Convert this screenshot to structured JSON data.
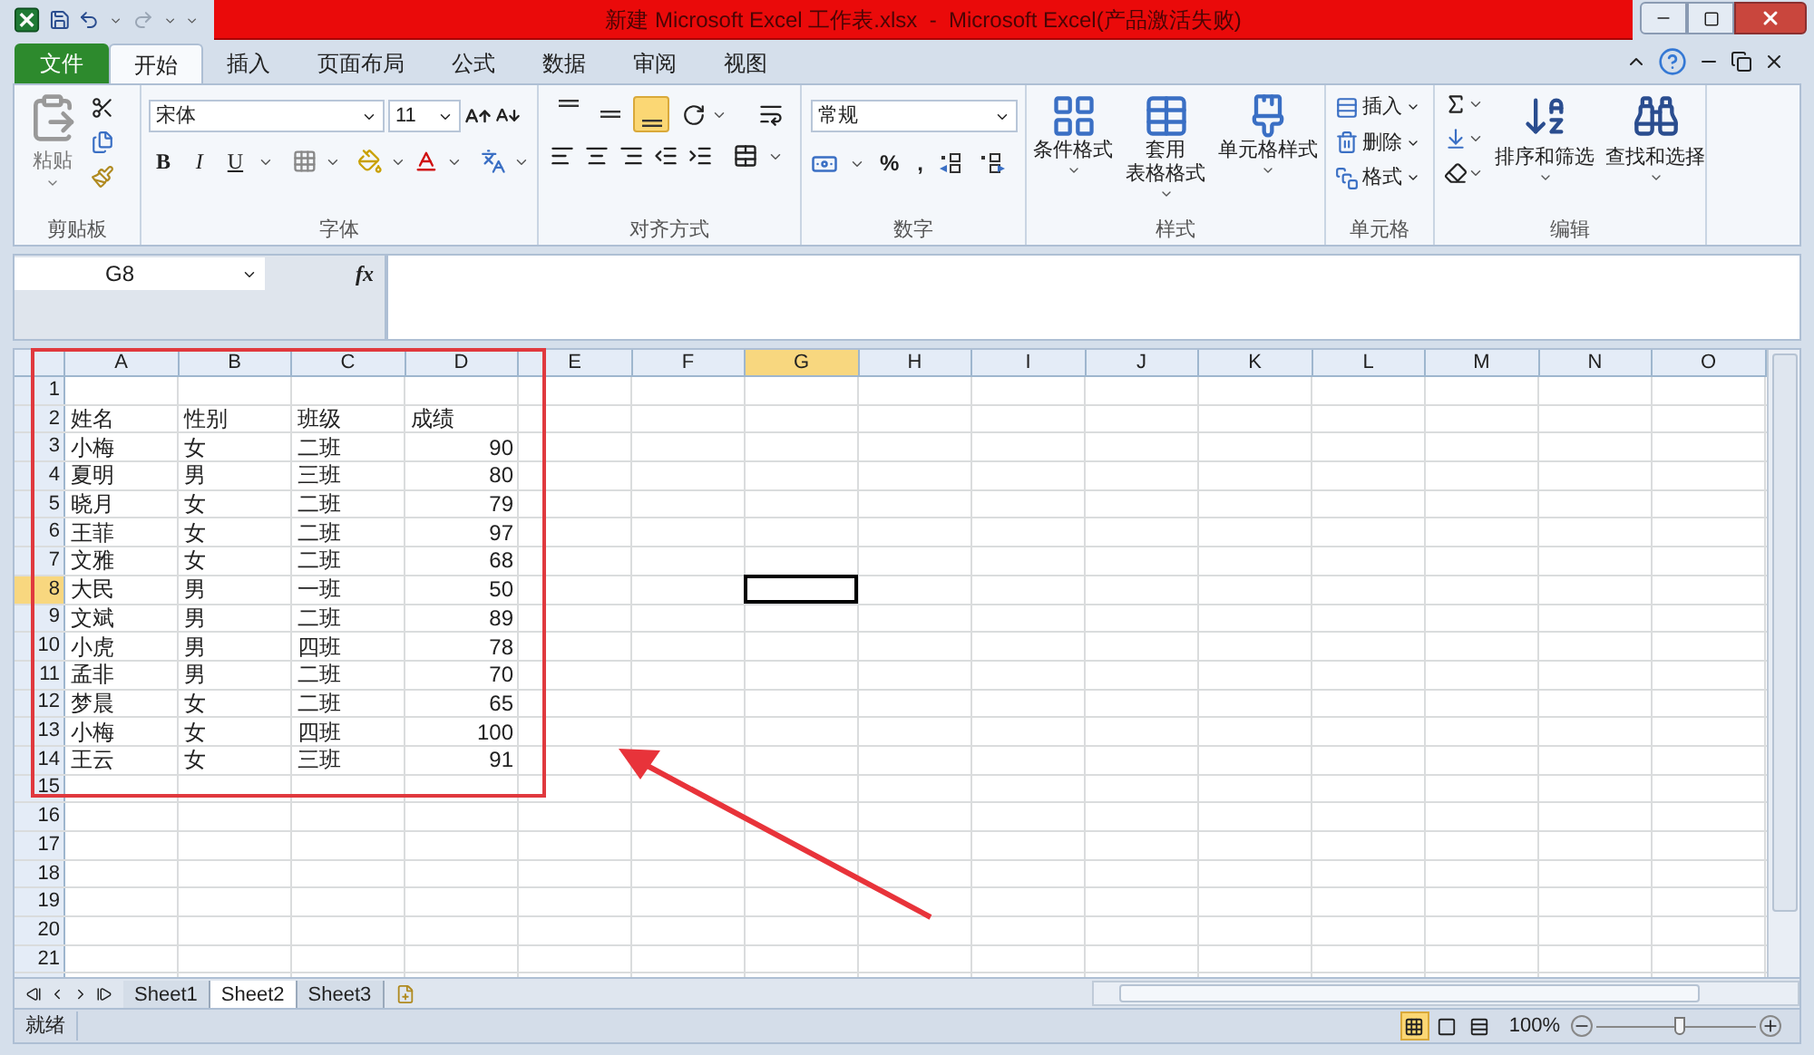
{
  "window": {
    "title": "新建 Microsoft Excel 工作表.xlsx  -  Microsoft Excel(产品激活失败)"
  },
  "ribbon_tabs": [
    {
      "label": "文件",
      "kind": "file",
      "selected": false
    },
    {
      "label": "开始",
      "kind": "tab",
      "selected": true
    },
    {
      "label": "插入",
      "kind": "tab",
      "selected": false
    },
    {
      "label": "页面布局",
      "kind": "tab",
      "selected": false
    },
    {
      "label": "公式",
      "kind": "tab",
      "selected": false
    },
    {
      "label": "数据",
      "kind": "tab",
      "selected": false
    },
    {
      "label": "审阅",
      "kind": "tab",
      "selected": false
    },
    {
      "label": "视图",
      "kind": "tab",
      "selected": false
    }
  ],
  "ribbon": {
    "clipboard": {
      "label": "剪贴板",
      "paste": "粘贴"
    },
    "font": {
      "label": "字体",
      "font_name": "宋体",
      "font_size": "11",
      "styles": [
        {
          "label": "B",
          "kind": "bold"
        },
        {
          "label": "I",
          "kind": "italic"
        },
        {
          "label": "U",
          "kind": "underline"
        }
      ]
    },
    "alignment": {
      "label": "对齐方式",
      "vertical_align": [
        {
          "kind": "top",
          "selected": false
        },
        {
          "kind": "middle",
          "selected": false
        },
        {
          "kind": "bottom",
          "selected": true
        }
      ]
    },
    "number": {
      "label": "数字",
      "format": "常规",
      "symbols": [
        "%",
        ","
      ]
    },
    "styles": {
      "label": "样式",
      "buttons": [
        {
          "lines": [
            "条件格式"
          ],
          "kind": "conditional"
        },
        {
          "lines": [
            "套用",
            "表格格式"
          ],
          "kind": "table"
        },
        {
          "lines": [
            "单元格样式"
          ],
          "kind": "cell"
        }
      ]
    },
    "cells": {
      "label": "单元格",
      "buttons": [
        {
          "label": "插入",
          "kind": "insert"
        },
        {
          "label": "删除",
          "kind": "delete"
        },
        {
          "label": "格式",
          "kind": "format"
        }
      ]
    },
    "editing": {
      "label": "编辑",
      "buttons": [
        {
          "label": "排序和筛选",
          "kind": "sort"
        },
        {
          "label": "查找和选择",
          "kind": "find"
        }
      ]
    }
  },
  "formula_bar": {
    "name_box": "G8",
    "function_label": "fx"
  },
  "sheet": {
    "columns": [
      {
        "label": "A",
        "selected": false
      },
      {
        "label": "B",
        "selected": false
      },
      {
        "label": "C",
        "selected": false
      },
      {
        "label": "D",
        "selected": false
      },
      {
        "label": "E",
        "selected": false
      },
      {
        "label": "F",
        "selected": false
      },
      {
        "label": "G",
        "selected": true
      },
      {
        "label": "H",
        "selected": false
      },
      {
        "label": "I",
        "selected": false
      },
      {
        "label": "J",
        "selected": false
      },
      {
        "label": "K",
        "selected": false
      },
      {
        "label": "L",
        "selected": false
      },
      {
        "label": "M",
        "selected": false
      },
      {
        "label": "N",
        "selected": false
      },
      {
        "label": "O",
        "selected": false
      }
    ],
    "rows": [
      {
        "label": "1",
        "selected": false
      },
      {
        "label": "2",
        "selected": false,
        "cells": [
          {
            "text": "姓名",
            "kind": "text"
          },
          {
            "text": "性别",
            "kind": "text"
          },
          {
            "text": "班级",
            "kind": "text"
          },
          {
            "text": "成绩",
            "kind": "text"
          }
        ]
      },
      {
        "label": "3",
        "selected": false,
        "cells": [
          {
            "text": "小梅",
            "kind": "text"
          },
          {
            "text": "女",
            "kind": "text"
          },
          {
            "text": "二班",
            "kind": "text"
          },
          {
            "text": "90",
            "kind": "number"
          }
        ]
      },
      {
        "label": "4",
        "selected": false,
        "cells": [
          {
            "text": "夏明",
            "kind": "text"
          },
          {
            "text": "男",
            "kind": "text"
          },
          {
            "text": "三班",
            "kind": "text"
          },
          {
            "text": "80",
            "kind": "number"
          }
        ]
      },
      {
        "label": "5",
        "selected": false,
        "cells": [
          {
            "text": "晓月",
            "kind": "text"
          },
          {
            "text": "女",
            "kind": "text"
          },
          {
            "text": "二班",
            "kind": "text"
          },
          {
            "text": "79",
            "kind": "number"
          }
        ]
      },
      {
        "label": "6",
        "selected": false,
        "cells": [
          {
            "text": "王菲",
            "kind": "text"
          },
          {
            "text": "女",
            "kind": "text"
          },
          {
            "text": "二班",
            "kind": "text"
          },
          {
            "text": "97",
            "kind": "number"
          }
        ]
      },
      {
        "label": "7",
        "selected": false,
        "cells": [
          {
            "text": "文雅",
            "kind": "text"
          },
          {
            "text": "女",
            "kind": "text"
          },
          {
            "text": "二班",
            "kind": "text"
          },
          {
            "text": "68",
            "kind": "number"
          }
        ]
      },
      {
        "label": "8",
        "selected": true,
        "cells": [
          {
            "text": "大民",
            "kind": "text"
          },
          {
            "text": "男",
            "kind": "text"
          },
          {
            "text": "一班",
            "kind": "text"
          },
          {
            "text": "50",
            "kind": "number"
          }
        ]
      },
      {
        "label": "9",
        "selected": false,
        "cells": [
          {
            "text": "文斌",
            "kind": "text"
          },
          {
            "text": "男",
            "kind": "text"
          },
          {
            "text": "二班",
            "kind": "text"
          },
          {
            "text": "89",
            "kind": "number"
          }
        ]
      },
      {
        "label": "10",
        "selected": false,
        "cells": [
          {
            "text": "小虎",
            "kind": "text"
          },
          {
            "text": "男",
            "kind": "text"
          },
          {
            "text": "四班",
            "kind": "text"
          },
          {
            "text": "78",
            "kind": "number"
          }
        ]
      },
      {
        "label": "11",
        "selected": false,
        "cells": [
          {
            "text": "孟非",
            "kind": "text"
          },
          {
            "text": "男",
            "kind": "text"
          },
          {
            "text": "二班",
            "kind": "text"
          },
          {
            "text": "70",
            "kind": "number"
          }
        ]
      },
      {
        "label": "12",
        "selected": false,
        "cells": [
          {
            "text": "梦晨",
            "kind": "text"
          },
          {
            "text": "女",
            "kind": "text"
          },
          {
            "text": "二班",
            "kind": "text"
          },
          {
            "text": "65",
            "kind": "number"
          }
        ]
      },
      {
        "label": "13",
        "selected": false,
        "cells": [
          {
            "text": "小梅",
            "kind": "text"
          },
          {
            "text": "女",
            "kind": "text"
          },
          {
            "text": "四班",
            "kind": "text"
          },
          {
            "text": "100",
            "kind": "number"
          }
        ]
      },
      {
        "label": "14",
        "selected": false,
        "cells": [
          {
            "text": "王云",
            "kind": "text"
          },
          {
            "text": "女",
            "kind": "text"
          },
          {
            "text": "三班",
            "kind": "text"
          },
          {
            "text": "91",
            "kind": "number"
          }
        ]
      },
      {
        "label": "15",
        "selected": false
      },
      {
        "label": "16",
        "selected": false
      },
      {
        "label": "17",
        "selected": false
      },
      {
        "label": "18",
        "selected": false
      },
      {
        "label": "19",
        "selected": false
      },
      {
        "label": "20",
        "selected": false
      },
      {
        "label": "21",
        "selected": false
      }
    ]
  },
  "sheet_tabs": [
    {
      "label": "Sheet1",
      "selected": false
    },
    {
      "label": "Sheet2",
      "selected": true
    },
    {
      "label": "Sheet3",
      "selected": false
    }
  ],
  "status_bar": {
    "text": "就绪",
    "view_buttons": [
      {
        "kind": "normal",
        "selected": true
      },
      {
        "kind": "page_layout",
        "selected": false
      },
      {
        "kind": "page_break",
        "selected": false
      }
    ],
    "zoom": "100%",
    "zoom_slider": {
      "level": 0.52
    }
  }
}
